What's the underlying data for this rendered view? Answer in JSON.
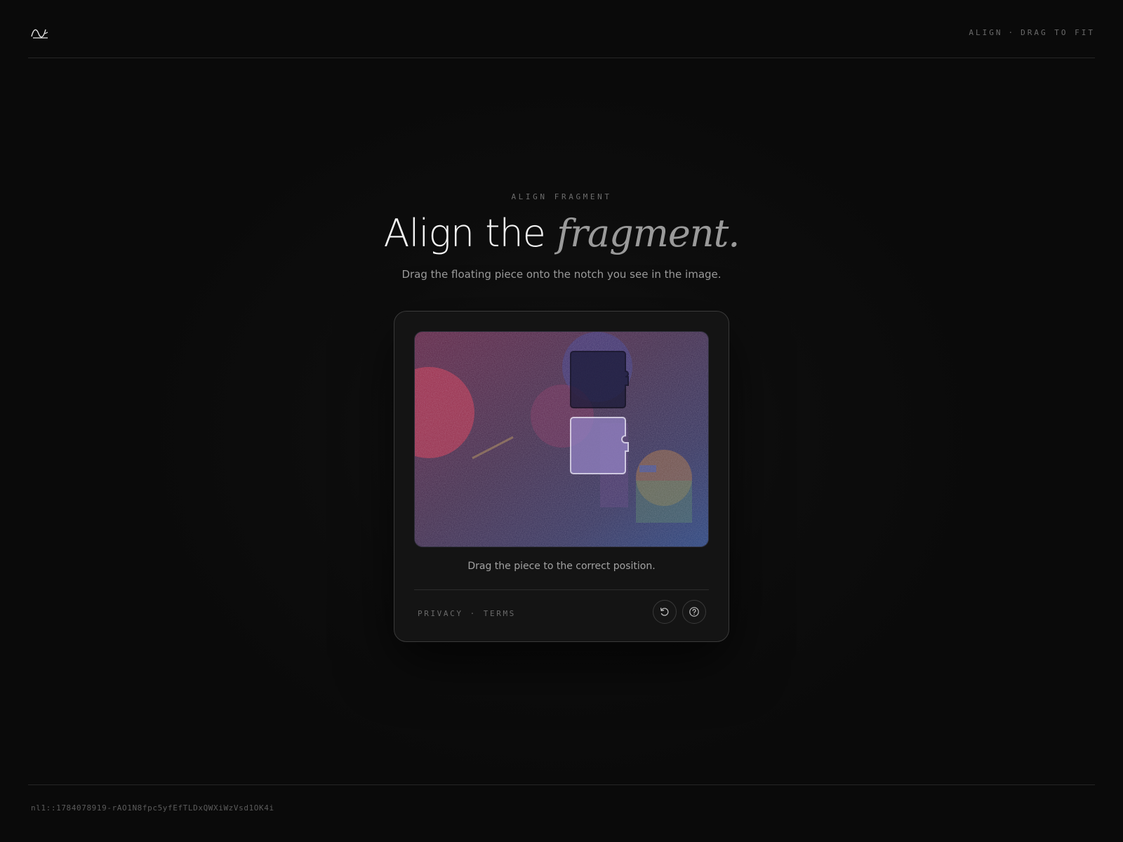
{
  "header": {
    "logo_icon": "wave-logo-icon",
    "mode": "ALIGN",
    "separator": "·",
    "instruction": "DRAG TO FIT"
  },
  "hero": {
    "eyebrow": "ALIGN FRAGMENT",
    "title_plain": "Align the",
    "title_accent": "fragment.",
    "subtitle": "Drag the floating piece onto the notch you see in the image."
  },
  "card": {
    "hint": "Drag the piece to the correct position.",
    "links": {
      "privacy": "PRIVACY",
      "separator": "·",
      "terms": "TERMS"
    },
    "refresh_icon": "refresh-icon",
    "help_icon": "help-icon"
  },
  "footer": {
    "token": "nl1::1784078919-rAO1N8fpc5yfEfTLDxQWXiWzVsd1OK4i"
  },
  "colors": {
    "background": "#0a0a0a",
    "card": "#141414",
    "accent_text": "#9a9a9a"
  }
}
